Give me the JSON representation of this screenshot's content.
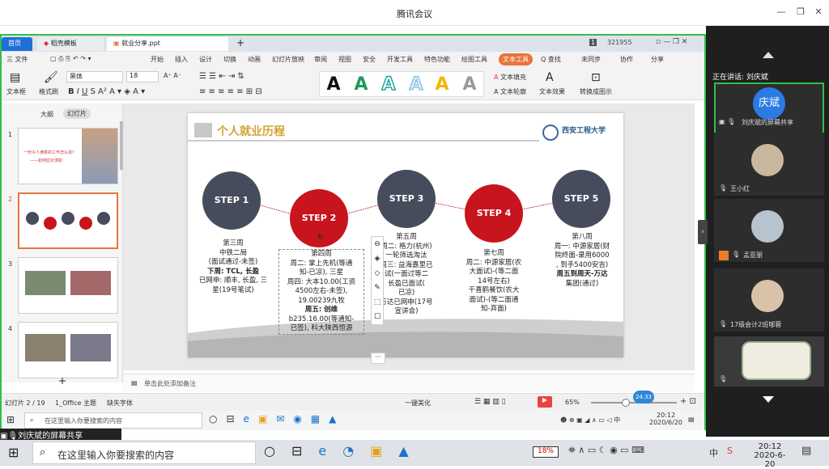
{
  "window": {
    "title": "腾讯会议"
  },
  "wps": {
    "tabs": [
      "首页",
      "稻壳模板",
      "就业分享.ppt"
    ],
    "user_id": "321955",
    "menu": [
      "三 文件",
      "开始",
      "插入",
      "设计",
      "切换",
      "动画",
      "幻灯片放映",
      "审阅",
      "视图",
      "安全",
      "开发工具",
      "特色功能",
      "绘图工具",
      "文本工具",
      "Q 查找",
      "未同步",
      "协作",
      "分享"
    ],
    "ribbon": {
      "textbox": "文本框",
      "format_brush": "格式刷",
      "font": "黑体",
      "size": "18",
      "text_fill": "文本填充",
      "text_outline": "文本轮廓",
      "text_effect": "文本效果",
      "convert": "转换成图示"
    },
    "pane_tabs": [
      "大纲",
      "幻灯片"
    ],
    "slides": [
      {
        "num": "1",
        "title": "一份令人满意的工作怎么找?",
        "subtitle": "——如何应对求职"
      },
      {
        "num": "2"
      },
      {
        "num": "3"
      },
      {
        "num": "4"
      }
    ],
    "notes_placeholder": "单击此处添加备注",
    "status": {
      "slide": "幻灯片 2 / 19",
      "theme": "1_Office 主题",
      "font_missing": "缺失字体",
      "beautify": "一键美化",
      "zoom": "65%",
      "tooltip": "24.33"
    }
  },
  "slide": {
    "heading": "个人就业历程",
    "logo_text": "西安工程大学",
    "steps": [
      {
        "label": "STEP 1",
        "week": "第三周",
        "lines": [
          "中铁二局",
          "(面试通过-未签)",
          "下周: TCL, 长盈",
          "已网申: 顺丰, 长盈, 三",
          "星(19号笔试)"
        ]
      },
      {
        "label": "STEP 2",
        "week": "第四周",
        "lines": [
          "周二: 掌上先机(等通",
          "知-已凉), 三星",
          "周四: 大本10.00(工资",
          "4500左右-未签),",
          "19.00239九牧",
          "周五: 创维",
          "b235.16.00(等通知-",
          "已签), 科大陕西恒源"
        ]
      },
      {
        "label": "STEP 3",
        "week": "第五周",
        "lines": [
          "周二: 格力(杭州)",
          "一轮筛选淘汰",
          "周三: 益海嘉里已",
          "试(一面过等二",
          "长盈已面试(",
          "已凉)",
          "万达已网申(17号",
          "宣讲会)"
        ]
      },
      {
        "label": "STEP 4",
        "week": "第七周",
        "lines": [
          "周二: 中源家居(农",
          "大面试)-(等二面",
          "14号左右)",
          "千喜鹤餐饮(农大",
          "面试)-(等二面通",
          "知-弃面)"
        ]
      },
      {
        "label": "STEP 5",
        "week": "第八周",
        "lines": [
          "周一: 中源家居(财",
          "院终面-录用6000",
          ", 到手5400安吉)",
          "周五到周天-万达",
          "集团(通过)"
        ]
      }
    ]
  },
  "inner_taskbar": {
    "search": "在这里输入你要搜索的内容",
    "time": "20:12",
    "date": "2020/6/20",
    "ime": "中"
  },
  "meeting": {
    "speaking": "正在讲话: 刘庆斌",
    "participants": [
      {
        "name": "刘庆斌的屏幕共享",
        "avatar": "庆斌"
      },
      {
        "name": "王小红"
      },
      {
        "name": "孟亚丽"
      },
      {
        "name": "17级会计2班郇蓉"
      }
    ],
    "sharer_label": "刘庆斌的屏幕共享"
  },
  "taskbar": {
    "search": "在这里输入你要搜索的内容",
    "battery": "18%",
    "ime": "中",
    "time": "20:12",
    "date": "2020-6-20"
  },
  "colors": {
    "accent_green": "#2fc04a",
    "step_dark": "#474c5c",
    "step_red": "#c8141c",
    "heading_gold": "#d4a23a"
  }
}
